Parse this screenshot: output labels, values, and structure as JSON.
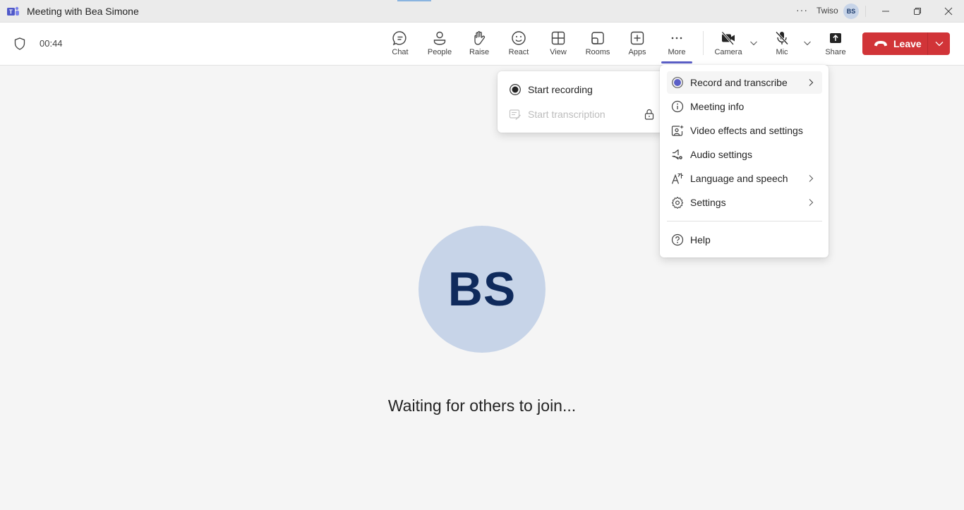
{
  "window": {
    "title": "Meeting with Bea Simone",
    "org_name": "Twiso",
    "user_initials": "BS",
    "more_glyph": "···"
  },
  "toolbar": {
    "timer": "00:44",
    "buttons": [
      {
        "id": "chat",
        "label": "Chat",
        "icon": "chat-icon"
      },
      {
        "id": "people",
        "label": "People",
        "icon": "people-icon"
      },
      {
        "id": "raise",
        "label": "Raise",
        "icon": "hand-icon"
      },
      {
        "id": "react",
        "label": "React",
        "icon": "smile-icon"
      },
      {
        "id": "view",
        "label": "View",
        "icon": "grid-icon"
      },
      {
        "id": "rooms",
        "label": "Rooms",
        "icon": "rooms-icon"
      },
      {
        "id": "apps",
        "label": "Apps",
        "icon": "plus-box-icon"
      },
      {
        "id": "more",
        "label": "More",
        "icon": "more-icon",
        "active": true
      },
      {
        "id": "camera",
        "label": "Camera",
        "icon": "camera-off-icon",
        "state": "off"
      },
      {
        "id": "mic",
        "label": "Mic",
        "icon": "mic-off-icon",
        "state": "muted"
      },
      {
        "id": "share",
        "label": "Share",
        "icon": "share-icon"
      }
    ],
    "leave_label": "Leave"
  },
  "stage": {
    "participant_initials": "BS",
    "status_text": "Waiting for others to join..."
  },
  "more_menu": {
    "items": [
      {
        "label": "Record and transcribe",
        "icon": "record-icon",
        "has_submenu": true,
        "highlighted": true
      },
      {
        "label": "Meeting info",
        "icon": "info-icon",
        "has_submenu": false
      },
      {
        "label": "Video effects and settings",
        "icon": "video-effects-icon",
        "has_submenu": false
      },
      {
        "label": "Audio settings",
        "icon": "audio-settings-icon",
        "has_submenu": false
      },
      {
        "label": "Language and speech",
        "icon": "language-icon",
        "has_submenu": true
      },
      {
        "label": "Settings",
        "icon": "gear-icon",
        "has_submenu": true
      },
      {
        "label": "Help",
        "icon": "help-icon",
        "has_submenu": false
      }
    ]
  },
  "record_submenu": {
    "items": [
      {
        "label": "Start recording",
        "icon": "record-icon",
        "enabled": true
      },
      {
        "label": "Start transcription",
        "icon": "transcript-icon",
        "enabled": false,
        "locked": true
      }
    ]
  },
  "colors": {
    "accent": "#5b5fc7",
    "leave": "#d13438",
    "avatar_bg": "#c7d4e8",
    "avatar_text": "#0f2a5c"
  }
}
